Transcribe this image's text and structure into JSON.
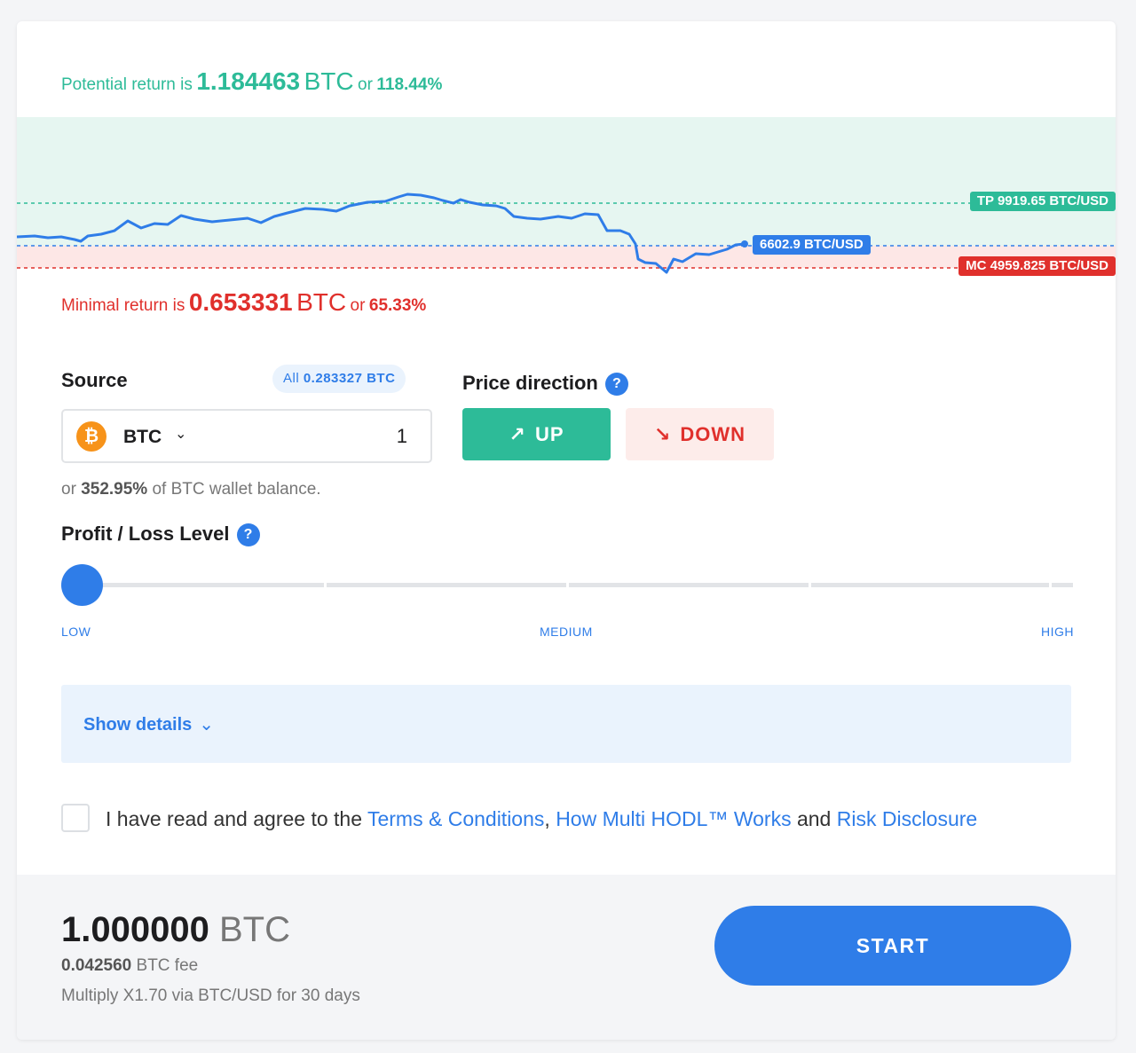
{
  "potential": {
    "label": "Potential return is",
    "amount": "1.184463",
    "currency": "BTC",
    "or": "or",
    "percent": "118.44%"
  },
  "minimal": {
    "label": "Minimal return is",
    "amount": "0.653331",
    "currency": "BTC",
    "or": "or",
    "percent": "65.33%"
  },
  "chart": {
    "tp_label": "TP 9919.65 BTC/USD",
    "current_label": "6602.9 BTC/USD",
    "mc_label": "MC 4959.825 BTC/USD",
    "colors": {
      "line": "#2f7de8",
      "profit_zone": "#e6f6f1",
      "loss_zone": "#fde7e6",
      "tp": "#2dbb98",
      "mc": "#e0302c"
    }
  },
  "source": {
    "title": "Source",
    "all_prefix": "All",
    "all_amount": "0.283327 BTC",
    "currency": "BTC",
    "chevron_icon": "chevron-down-icon",
    "amount": "1",
    "note_prefix": "or",
    "note_percent": "352.95%",
    "note_suffix": "of BTC wallet balance."
  },
  "direction": {
    "title": "Price direction",
    "help": "?",
    "up_label": "UP",
    "up_arrow": "↗",
    "down_label": "DOWN",
    "down_arrow": "↘"
  },
  "level": {
    "title": "Profit / Loss Level",
    "help": "?",
    "value_fraction": 0,
    "low": "LOW",
    "medium": "MEDIUM",
    "high": "HIGH"
  },
  "details": {
    "label": "Show details",
    "chevron": "⌄"
  },
  "agreement": {
    "prefix": "I have read and agree to the",
    "terms": "Terms & Conditions",
    "comma": ",",
    "how": "How Multi HODL™ Works",
    "and": "and",
    "risk": "Risk Disclosure"
  },
  "footer": {
    "amount": "1.000000",
    "currency": "BTC",
    "fee_amount": "0.042560",
    "fee_label": "BTC fee",
    "multiply": "Multiply X1.70 via BTC/USD for 30 days",
    "start": "START"
  }
}
